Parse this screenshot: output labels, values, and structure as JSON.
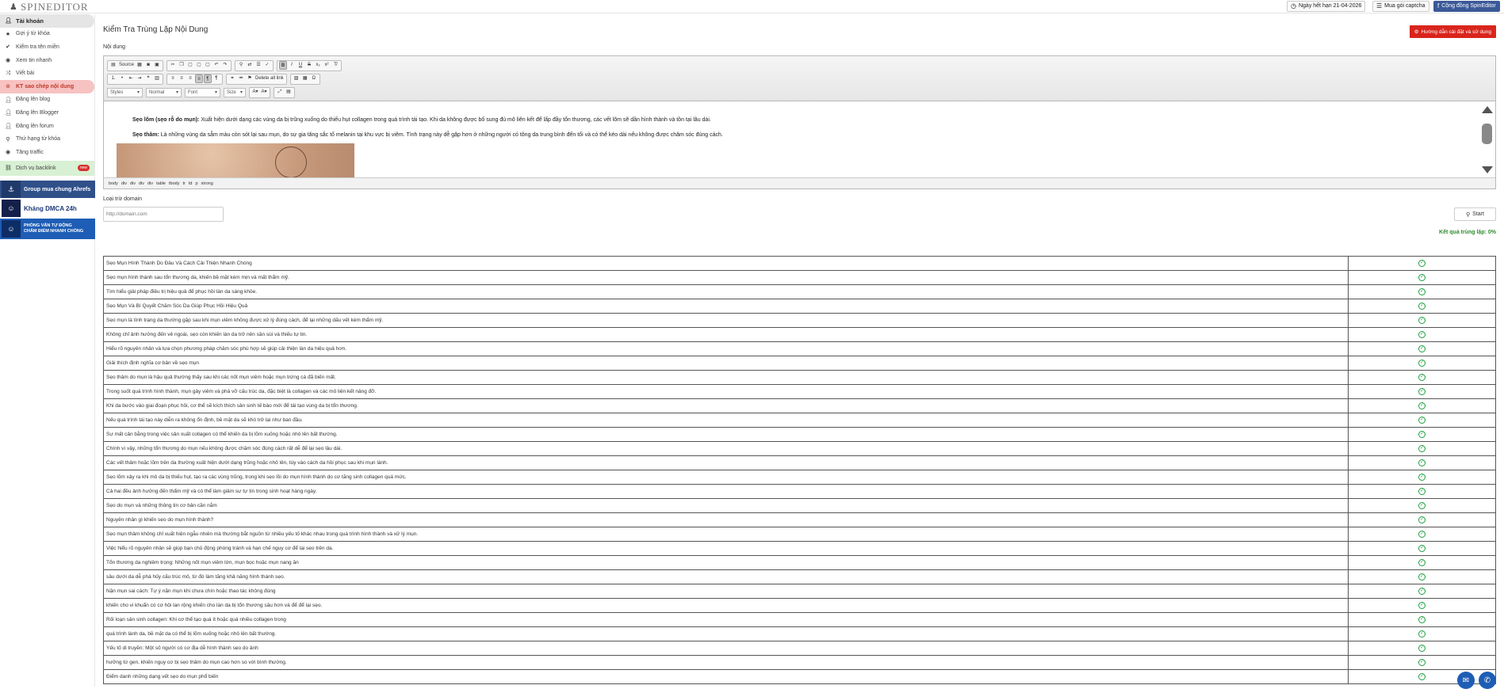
{
  "topbar": {
    "logo_text": "SPINEDITOR",
    "expiry": "Ngày hết hạn 21-04-2026",
    "buy_captcha": "Mua gói captcha",
    "community": "Cộng đồng SpinEditor"
  },
  "sidebar": {
    "items": [
      {
        "label": "Tài khoản",
        "icon": "user-icon"
      },
      {
        "label": "Gợi ý từ khóa",
        "icon": "star-icon"
      },
      {
        "label": "Kiểm tra tên miền",
        "icon": "check-icon"
      },
      {
        "label": "Xem tin nhanh",
        "icon": "eye-icon"
      },
      {
        "label": "Viết bài",
        "icon": "shuffle-icon"
      },
      {
        "label": "KT sao chép nội dung",
        "icon": "circle-check-icon"
      },
      {
        "label": "Đăng lên blog",
        "icon": "user-icon"
      },
      {
        "label": "Đăng lên Blogger",
        "icon": "user-icon"
      },
      {
        "label": "Đăng lên forum",
        "icon": "user-icon"
      },
      {
        "label": "Thứ hạng từ khóa",
        "icon": "search-icon"
      },
      {
        "label": "Tăng traffic",
        "icon": "eye-icon"
      }
    ],
    "backlink": {
      "label": "Dịch vụ backlink",
      "badge": "new"
    },
    "banners": {
      "ahrefs": "Group mua chung Ahrefs",
      "dmca": "Kháng DMCA 24h",
      "interview_line1": "PHỎNG VẤN TỰ ĐỘNG",
      "interview_line2": "CHẤM ĐIỂM NHANH CHÓNG"
    }
  },
  "main": {
    "title": "Kiểm Tra Trùng Lặp Nội Dung",
    "guide_button": "Hướng dẫn cài đặt và sử dụng",
    "content_label": "Nội dung",
    "toolbar": {
      "source": "Source",
      "delete_all_link": "Delete all link",
      "styles": "Styles",
      "format": "Normal",
      "font": "Font",
      "size": "Size"
    },
    "editor": {
      "lines": [
        {
          "bold": "Sẹo lõm (sẹo rỗ do mụn):",
          "text": " Xuất hiện dưới dạng các vùng da bị trũng xuống do thiếu hụt collagen trong quá trình tái tạo. Khi da không được bổ sung đủ mô liên kết để lấp đầy tổn thương, các vết lõm sẽ dần hình thành và tồn tại lâu dài."
        },
        {
          "bold": "Sẹo thâm:",
          "text": " Là những vùng da sẫm màu còn sót lại sau mụn, do sự gia tăng sắc tố melanin tại khu vực bị viêm. Tình trạng này dễ gặp hơn ở những người có tông da trung bình đến tối và có thể kéo dài nếu không được chăm sóc đúng cách."
        }
      ],
      "path": [
        "body",
        "div",
        "div",
        "div",
        "div",
        "table",
        "tbody",
        "tr",
        "td",
        "p",
        "strong"
      ]
    },
    "exclude_label": "Loại trừ domain",
    "domain_placeholder": "http://domain.com",
    "start_button": "Start",
    "result_text": "Kết quả trùng lặp: 0%"
  },
  "rows": [
    "Sẹo Mụn Hình Thành Do Đâu Và Cách Cải Thiện Nhanh Chóng",
    "Sẹo mụn hình thành sau tổn thương da, khiến bề mặt kém mịn và mất thẩm mỹ.",
    "Tìm hiểu giải pháp điều trị hiệu quả để phục hồi làn da sáng khỏe.",
    "Sẹo Mụn Và Bí Quyết Chăm Sóc Da Giúp Phục Hồi Hiệu Quả",
    "Sẹo mụn là tình trạng da thường gặp sau khi mụn viêm không được xử lý đúng cách, để lại những dấu vết kém thẩm mỹ.",
    "Không chỉ ảnh hưởng đến vẻ ngoài, sẹo còn khiến làn da trở nên sần sùi và thiếu tự tin.",
    "Hiểu rõ nguyên nhân và lựa chọn phương pháp chăm sóc phù hợp sẽ giúp cải thiện làn da hiệu quả hơn.",
    "Giải thích định nghĩa cơ bản về sẹo mụn",
    "Sẹo thâm do mụn là hậu quả thường thấy sau khi các nốt mụn viêm hoặc mụn trứng cá đã biến mất.",
    "Trong suốt quá trình hình thành, mụn gây viêm và phá vỡ cấu trúc da, đặc biệt là collagen và các mô liên kết nâng đỡ.",
    "Khi da bước vào giai đoạn phục hồi, cơ thể sẽ kích thích sản sinh tế bào mới để tái tạo vùng da bị tổn thương.",
    "Nếu quá trình tái tạo này diễn ra không ổn định, bề mặt da sẽ khó trở lại như ban đầu.",
    "Sự mất cân bằng trong việc sản xuất collagen có thể khiến da bị lõm xuống hoặc nhô lên bất thường.",
    "Chính vì vậy, những tổn thương do mụn nếu không được chăm sóc đúng cách rất dễ để lại sẹo lâu dài.",
    "Các vết thâm hoặc lõm trên da thường xuất hiện dưới dạng trũng hoặc nhô lên, tùy vào cách da hồi phục sau khi mụn lành.",
    "Sẹo lõm xảy ra khi mô da bị thiếu hụt, tạo ra các vùng trũng, trong khi sẹo lồi do mụn hình thành do cơ tăng sinh collagen quá mức.",
    "Cả hai đều ảnh hưởng đến thẩm mỹ và có thể làm giảm sự tự tin trong sinh hoạt hàng ngày.",
    "Sẹo do mụn và những thông tin cơ bản cần nắm",
    "Nguyên nhân gì khiến sẹo do mụn hình thành?",
    "Sẹo mụn thâm không chỉ xuất hiện ngẫu nhiên mà thường bắt nguồn từ nhiều yếu tố khác nhau trong quá trình hình thành và xử lý mụn.",
    "Việc hiểu rõ nguyên nhân sẽ giúp bạn chủ động phòng tránh và hạn chế nguy cơ để lại sẹo trên da.",
    "Tổn thương da nghiêm trọng: Những nốt mụn viêm lớn, mụn bọc hoặc mụn nang ăn",
    "sâu dưới da dễ phá hủy cấu trúc mô, từ đó làm tăng khả năng hình thành sẹo.",
    "Nặn mụn sai cách: Tự ý nặn mụn khi chưa chín hoặc thao tác không đúng",
    "khiến cho vi khuẩn có cơ hội lan rộng khiến cho làn da bị tổn thương sâu hơn và để để lại sẹo.",
    "Rối loạn sản sinh collagen: Khi cơ thể tạo quá ít hoặc quá nhiều collagen trong",
    "quá trình lành da, bề mặt da có thể bị lõm xuống hoặc nhô lên bất thường.",
    "Yếu tố di truyền: Một số người có cơ địa dễ hình thành sẹo do ảnh",
    "hưởng từ gen, khiến nguy cơ bị sẹo thâm do mụn cao hơn so với bình thường.",
    "Điểm danh những dạng vết sẹo do mụn phổ biến"
  ],
  "colors": {
    "accent_red": "#d9251c",
    "active_bg": "#f7c2c2",
    "ok_green": "#1e9e3e",
    "facebook_blue": "#3b5998"
  }
}
